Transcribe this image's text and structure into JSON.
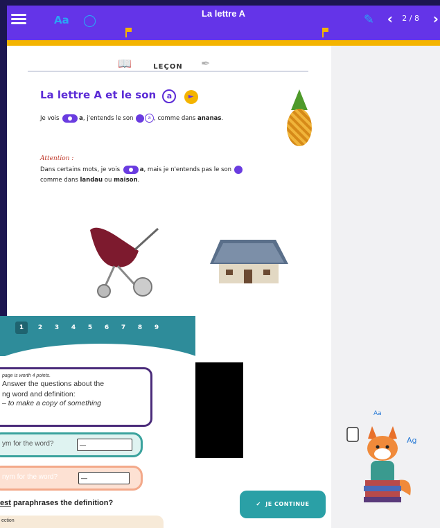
{
  "topbar": {
    "title": "La lettre A",
    "page_counter": "2 / 8",
    "prev_icon": "chevron-left-icon",
    "next_icon": "chevron-right-icon",
    "tool_text": "Aa"
  },
  "lesson": {
    "section_label": "LEÇON",
    "heading": "La lettre A et le son",
    "heading_sound": "a",
    "line1_a": "Je vois",
    "line1_b": "a",
    "line1_c": ", j'entends le son",
    "line1_d": ", comme dans",
    "line1_word": "ananas",
    "attention_label": "Attention :",
    "note_a": "Dans certains mots, je vois",
    "note_b": "a",
    "note_c": ", mais je n'entends pas le son",
    "note_d": "comme dans",
    "note_word1": "landau",
    "note_or": "ou",
    "note_word2": "maison",
    "continue_label": "JE CONTINUE"
  },
  "quiz": {
    "steps": [
      "1",
      "2",
      "3",
      "4",
      "5",
      "6",
      "7",
      "8",
      "9"
    ],
    "active_step": "1",
    "worth": "page is worth 4 points.",
    "instruction_line1": "Answer the questions about the",
    "instruction_line2": "ng word and definition:",
    "definition": "– to make a copy of something",
    "answer1_label": "ym for the word?",
    "answer1_value": "—",
    "answer2_label": "nym for the word?",
    "answer2_value": "—",
    "q3_bold": "est",
    "q3_rest": " paraphrases the definition?",
    "option_text": "ection"
  },
  "colors": {
    "topbar": "#6434e8",
    "accent": "#f4b400",
    "heading": "#5b2bd6",
    "continue": "#2aa0a6"
  }
}
